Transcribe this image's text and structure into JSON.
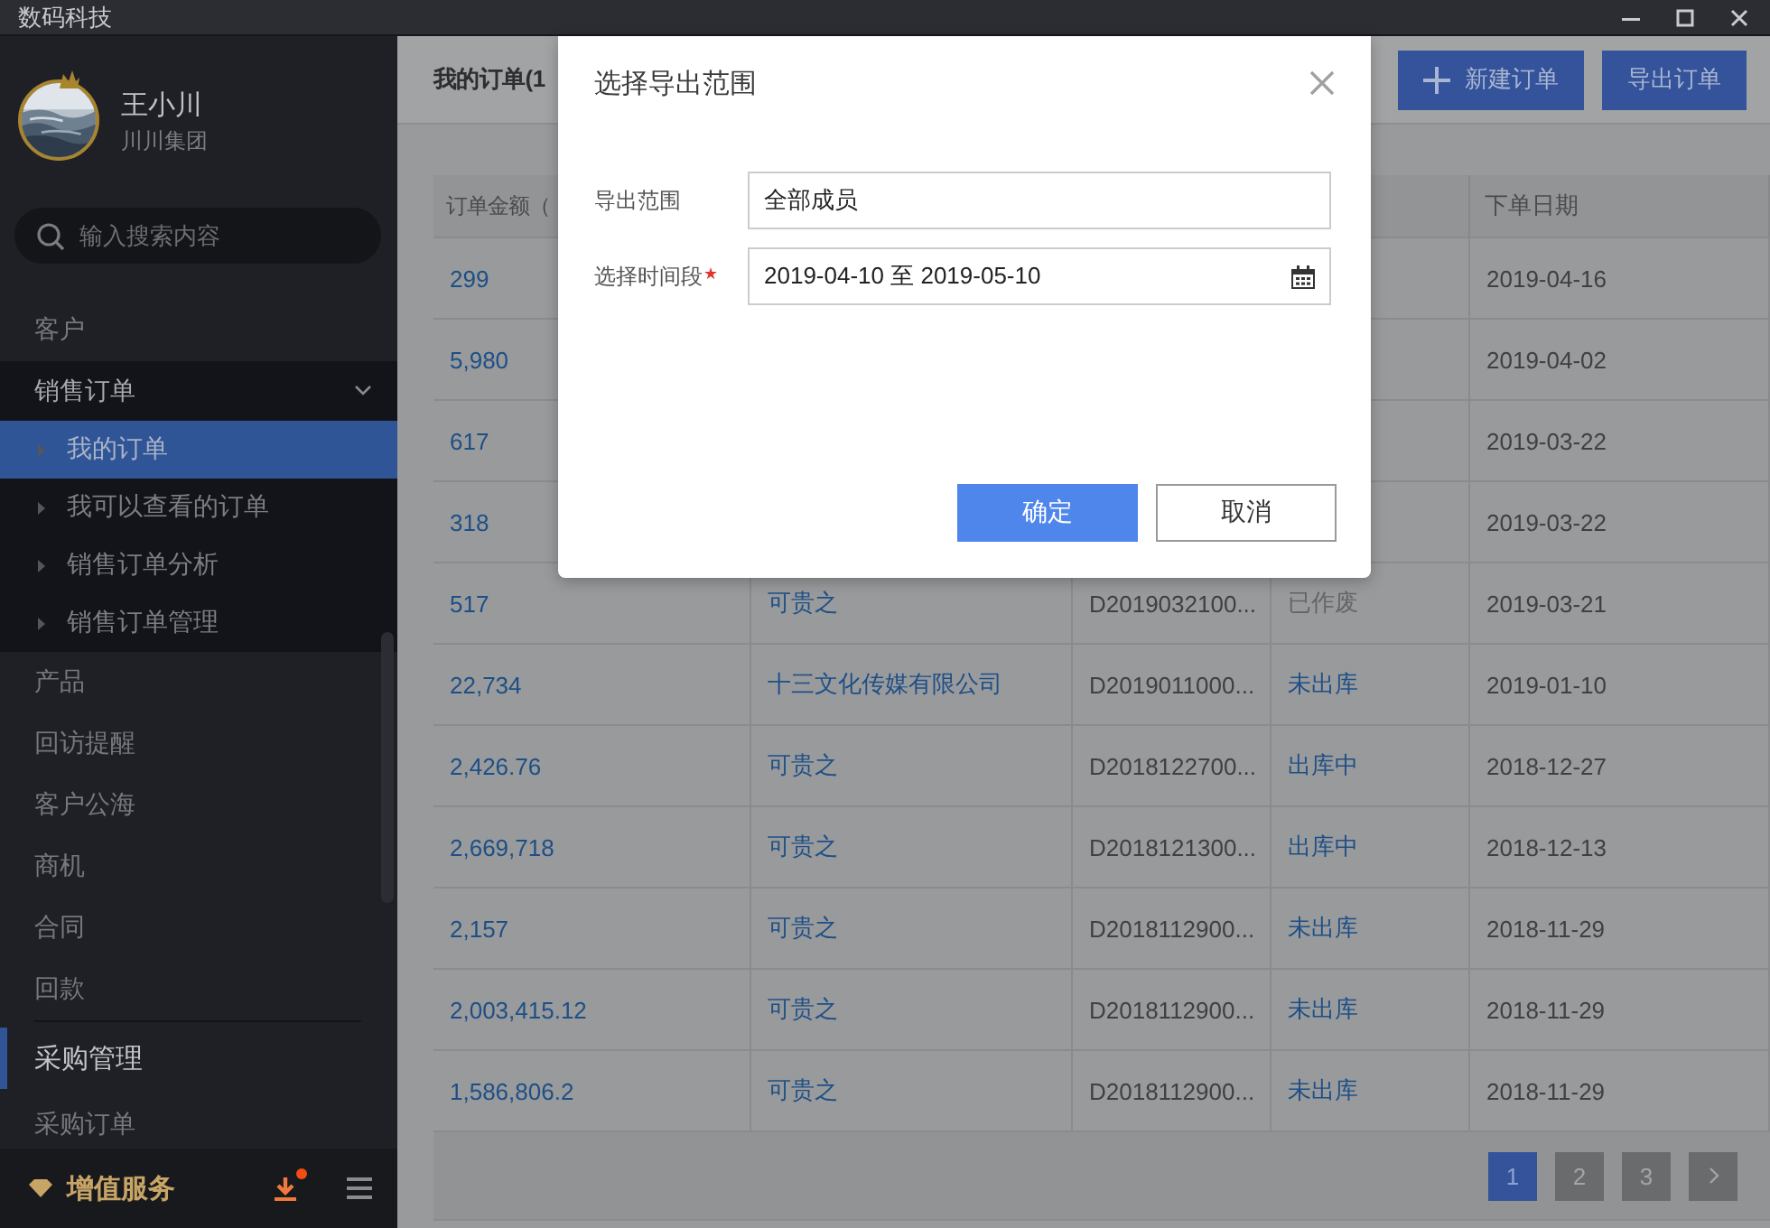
{
  "window": {
    "title": "数码科技"
  },
  "sidebar": {
    "user": {
      "name": "王小川",
      "company": "川川集团"
    },
    "search": {
      "placeholder": "输入搜索内容"
    },
    "menu": [
      {
        "kind": "item",
        "label": "客户",
        "selected": false
      },
      {
        "kind": "group",
        "label": "销售订单",
        "expanded": true,
        "children": [
          {
            "label": "我的订单",
            "selected": true
          },
          {
            "label": "我可以查看的订单",
            "selected": false
          },
          {
            "label": "销售订单分析",
            "selected": false
          },
          {
            "label": "销售订单管理",
            "selected": false
          }
        ]
      },
      {
        "kind": "item",
        "label": "产品",
        "selected": false
      },
      {
        "kind": "item",
        "label": "回访提醒",
        "selected": false
      },
      {
        "kind": "item",
        "label": "客户公海",
        "selected": false
      },
      {
        "kind": "item",
        "label": "商机",
        "selected": false
      },
      {
        "kind": "item",
        "label": "合同",
        "selected": false
      },
      {
        "kind": "item",
        "label": "回款",
        "selected": false
      },
      {
        "kind": "section",
        "label": "采购管理",
        "selected": true
      },
      {
        "kind": "item",
        "label": "采购订单",
        "selected": false
      }
    ],
    "footer": {
      "label": "增值服务",
      "download_notification": true
    }
  },
  "main": {
    "title": "我的订单(1",
    "buttons": [
      {
        "kind": "add",
        "label": "新建订单"
      },
      {
        "kind": "plain",
        "label": "导出订单"
      }
    ],
    "table": {
      "columns": [
        {
          "label": "订单金额（"
        },
        {
          "label": "下单日期"
        }
      ],
      "rows": [
        {
          "amount": "299",
          "date": "2019-04-16"
        },
        {
          "amount": "5,980",
          "date": "2019-04-02"
        },
        {
          "amount": "617",
          "date": "2019-03-22"
        },
        {
          "amount": "318",
          "date": "2019-03-22"
        },
        {
          "amount": "517",
          "customer": "可贵之",
          "number": "D2019032100...",
          "status": {
            "text": "已作废",
            "muted": true
          },
          "date": "2019-03-21"
        },
        {
          "amount": "22,734",
          "customer": "十三文化传媒有限公司",
          "number": "D2019011000...",
          "status": {
            "text": "未出库",
            "muted": false
          },
          "date": "2019-01-10"
        },
        {
          "amount": "2,426.76",
          "customer": "可贵之",
          "number": "D2018122700...",
          "status": {
            "text": "出库中",
            "muted": false
          },
          "date": "2018-12-27"
        },
        {
          "amount": "2,669,718",
          "customer": "可贵之",
          "number": "D2018121300...",
          "status": {
            "text": "出库中",
            "muted": false
          },
          "date": "2018-12-13"
        },
        {
          "amount": "2,157",
          "customer": "可贵之",
          "number": "D2018112900...",
          "status": {
            "text": "未出库",
            "muted": false
          },
          "date": "2018-11-29"
        },
        {
          "amount": "2,003,415.12",
          "customer": "可贵之",
          "number": "D2018112900...",
          "status": {
            "text": "未出库",
            "muted": false
          },
          "date": "2018-11-29"
        },
        {
          "amount": "1,586,806.2",
          "customer": "可贵之",
          "number": "D2018112900...",
          "status": {
            "text": "未出库",
            "muted": false
          },
          "date": "2018-11-29"
        }
      ]
    },
    "pagination": [
      {
        "label": "1",
        "selected": true
      },
      {
        "label": "2",
        "selected": false
      },
      {
        "label": "3",
        "selected": false
      }
    ]
  },
  "dialog": {
    "title": "选择导出范围",
    "fields": [
      {
        "kind": "text",
        "label": "导出范围",
        "value": "全部成员",
        "required": false
      },
      {
        "kind": "date-range",
        "label": "选择时间段",
        "value": "2019-04-10 至 2019-05-10",
        "required": true
      }
    ],
    "buttons": [
      {
        "kind": "primary",
        "label": "确定"
      },
      {
        "kind": "default",
        "label": "取消"
      }
    ]
  }
}
